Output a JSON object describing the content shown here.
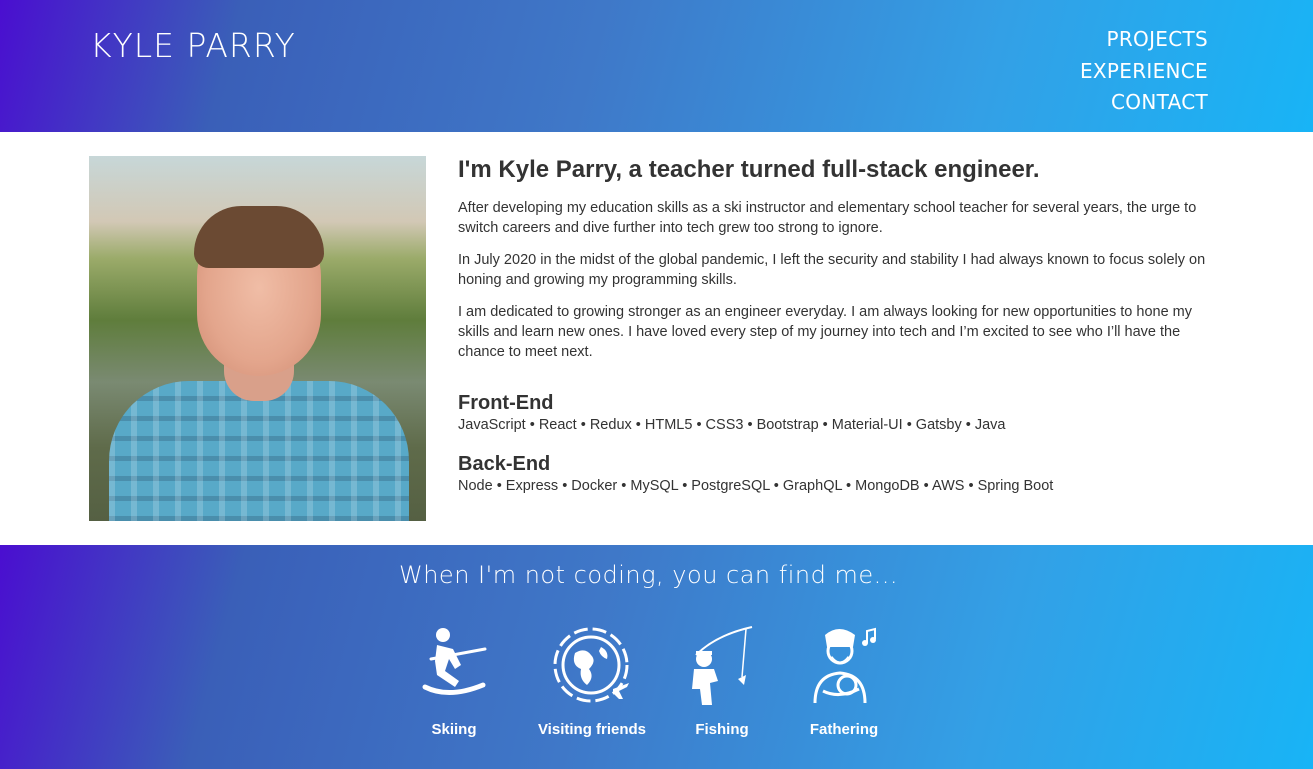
{
  "header": {
    "brand": "KYLE PARRY",
    "nav": [
      "PROJECTS",
      "EXPERIENCE",
      "CONTACT"
    ]
  },
  "intro": {
    "heading": "I'm Kyle Parry, a teacher turned full-stack engineer.",
    "paragraphs": [
      "After developing my education skills as a ski instructor and elementary school teacher for several years, the urge to switch careers and dive further into tech grew too strong to ignore.",
      "In July 2020 in the midst of the global pandemic, I left the security and stability I had always known to focus solely on honing and growing my programming skills.",
      "I am dedicated to growing stronger as an engineer everyday. I am always looking for new opportunities to hone my skills and learn new ones. I have loved every step of my journey into tech and I’m excited to see who I’ll have the chance to meet next."
    ]
  },
  "skills": {
    "frontend_title": "Front-End",
    "frontend_list": "JavaScript • React • Redux • HTML5 • CSS3 • Bootstrap • Material-UI • Gatsby • Java",
    "backend_title": "Back-End",
    "backend_list": "Node • Express • Docker • MySQL • PostgreSQL • GraphQL • MongoDB • AWS • Spring Boot"
  },
  "footer": {
    "tagline": "When I'm not coding, you can find me...",
    "hobbies": [
      {
        "label": "Skiing",
        "icon": "skier-icon"
      },
      {
        "label": "Visiting friends",
        "icon": "globe-plane-icon"
      },
      {
        "label": "Fishing",
        "icon": "fisherman-icon"
      },
      {
        "label": "Fathering",
        "icon": "father-baby-icon"
      }
    ]
  },
  "colors": {
    "gradient_start": "#4a0ed0",
    "gradient_end": "#18b4f6",
    "text": "#333333"
  }
}
